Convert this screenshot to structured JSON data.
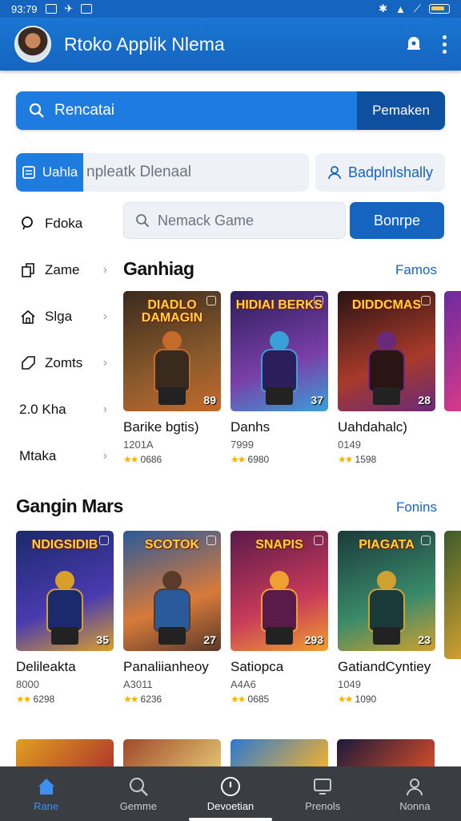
{
  "status_bar": {
    "time": "93:79"
  },
  "app_bar": {
    "title": "Rtoko Applik Nlema"
  },
  "search": {
    "placeholder": "Rencatai",
    "button_label": "Pemaken"
  },
  "filter": {
    "chip_label": "Uahla",
    "placeholder": "npleatk Dlenaal",
    "button_label": "Badplnlshally"
  },
  "sidebar": {
    "items": [
      {
        "label": "Fdoka",
        "icon": "search-icon"
      },
      {
        "label": "Zame",
        "icon": "page-icon"
      },
      {
        "label": "Slga",
        "icon": "home-icon"
      },
      {
        "label": "Zomts",
        "icon": "tag-icon"
      },
      {
        "label": "2.0 Kha",
        "icon": ""
      },
      {
        "label": "Mtaka",
        "icon": ""
      }
    ]
  },
  "game_search": {
    "placeholder": "Nemack Game",
    "button_label": "Bonrpe"
  },
  "section1": {
    "title": "Ganhiag",
    "link": "Famos",
    "cards": [
      {
        "logo": "DIADLO DAMAGIN",
        "title": "Barike bgtis)",
        "sub": "1201A",
        "rating": "0686",
        "num": "89",
        "palette": [
          "#3a2a1e",
          "#8a5a2c",
          "#c46a2a"
        ]
      },
      {
        "logo": "HIDIAI BERKS",
        "title": "Danhs",
        "sub": "7999",
        "rating": "6980",
        "num": "37",
        "palette": [
          "#2b1e5a",
          "#7a3fa8",
          "#3aa0d8"
        ]
      },
      {
        "logo": "DIDDCMAS",
        "title": "Uahdahalc)",
        "sub": "0149",
        "rating": "1598",
        "num": "28",
        "palette": [
          "#2a1414",
          "#a83a2a",
          "#6a2a7a"
        ]
      }
    ]
  },
  "section2": {
    "title": "Gangin Mars",
    "link": "Fonins",
    "cards": [
      {
        "logo": "NDIGSIDIB",
        "title": "Delileakta",
        "sub": "8000",
        "rating": "6298",
        "num": "35",
        "palette": [
          "#1a2a6a",
          "#4a3ab0",
          "#d8a02a"
        ]
      },
      {
        "logo": "SCOTOK",
        "title": "Panaliianheoy",
        "sub": "A3011",
        "rating": "6236",
        "num": "27",
        "palette": [
          "#2a5a9a",
          "#d87a3a",
          "#5a3a2a"
        ]
      },
      {
        "logo": "SNAPIS",
        "title": "Satiopca",
        "sub": "A4A6",
        "rating": "0685",
        "num": "293",
        "palette": [
          "#5a1a4a",
          "#c83a5a",
          "#f0a030"
        ]
      },
      {
        "logo": "PIAGATA",
        "title": "GatiandCyntiey",
        "sub": "1049",
        "rating": "1090",
        "num": "23",
        "palette": [
          "#1a3a3a",
          "#3a8a6a",
          "#d0a030"
        ]
      }
    ]
  },
  "bottom_nav": {
    "items": [
      {
        "label": "Rane",
        "icon": "home-icon",
        "active": true
      },
      {
        "label": "Gemme",
        "icon": "search-icon",
        "active": false
      },
      {
        "label": "Devoetian",
        "icon": "clock-icon",
        "active": false
      },
      {
        "label": "Prenols",
        "icon": "monitor-icon",
        "active": false
      },
      {
        "label": "Nonna",
        "icon": "person-icon",
        "active": false
      }
    ]
  },
  "colors": {
    "primary": "#1565c0",
    "accent": "#1e7be0",
    "star": "#f4b400"
  }
}
